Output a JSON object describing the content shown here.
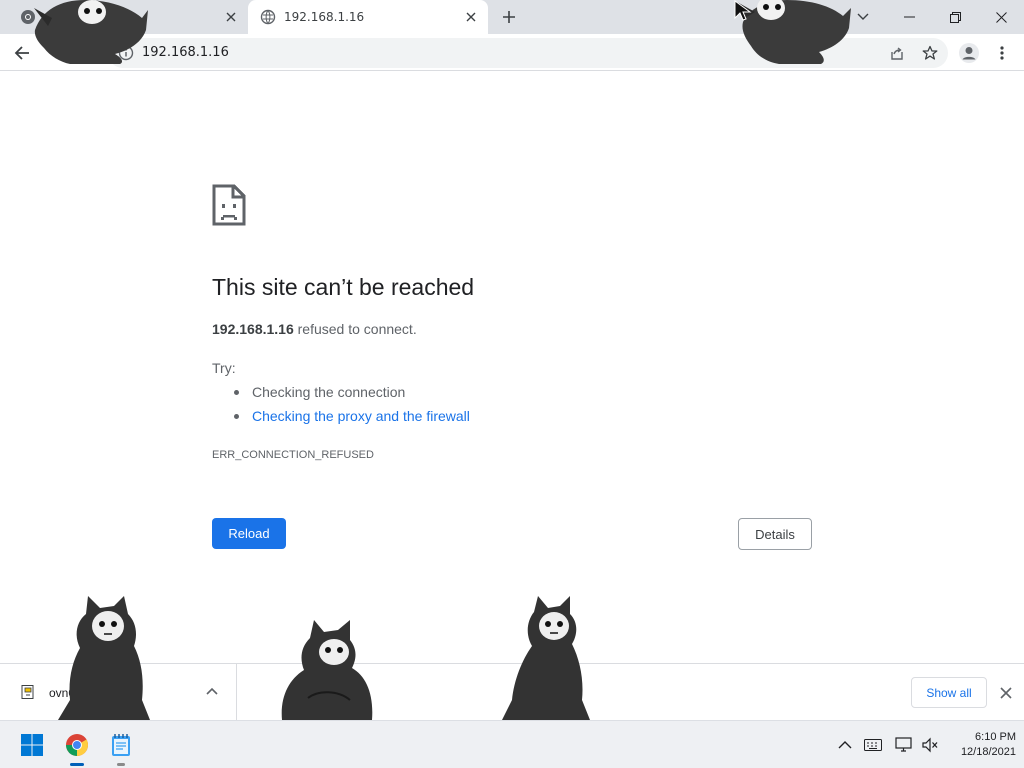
{
  "browser": {
    "tabs": [
      {
        "title": "",
        "favicon": "chrome-icon",
        "active": false
      },
      {
        "title": "192.168.1.16",
        "favicon": "globe-icon",
        "active": true
      }
    ],
    "new_tab_icon": "plus-icon",
    "window_controls": [
      "tab-search-icon",
      "minimize-icon",
      "restore-icon",
      "close-icon"
    ],
    "address_bar": {
      "url": "192.168.1.16",
      "info_icon": "info-icon"
    },
    "toolbar_icons": [
      "back-arrow-icon",
      "share-icon",
      "star-icon",
      "profile-icon",
      "menu-icon"
    ]
  },
  "error_page": {
    "title": "This site can’t be reached",
    "host": "192.168.1.16",
    "message": " refused to connect.",
    "try_label": "Try:",
    "suggestions": [
      {
        "text": "Checking the connection",
        "link": false
      },
      {
        "text": "Checking the proxy and the firewall",
        "link": true
      }
    ],
    "error_code": "ERR_CONNECTION_REFUSED",
    "reload_label": "Reload",
    "details_label": "Details"
  },
  "download_shelf": {
    "file_name": "ovn0a",
    "show_all_label": "Show all"
  },
  "taskbar": {
    "apps": [
      "windows-start-icon",
      "chrome-icon",
      "notepad-icon"
    ],
    "tray_icons": [
      "chevron-up-icon",
      "keyboard-icon",
      "network-icon",
      "volume-muted-icon"
    ],
    "time": "6:10 PM",
    "date": "12/18/2021"
  },
  "colors": {
    "accent": "#1a73e8",
    "tabstrip": "#dee1e6",
    "taskbar": "#eef0f3"
  }
}
